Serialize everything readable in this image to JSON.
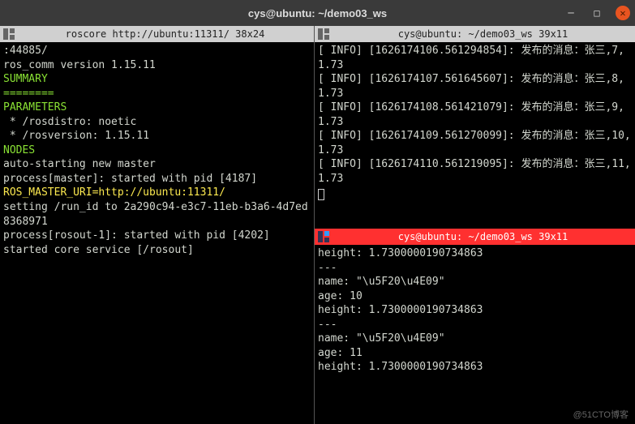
{
  "window": {
    "title": "cys@ubuntu: ~/demo03_ws"
  },
  "left": {
    "tab": "roscore http://ubuntu:11311/ 38x24",
    "lines": [
      {
        "cls": "c-white",
        "text": ":44885/"
      },
      {
        "cls": "c-white",
        "text": "ros_comm version 1.15.11"
      },
      {
        "cls": "",
        "text": ""
      },
      {
        "cls": "",
        "text": ""
      },
      {
        "cls": "c-green",
        "text": "SUMMARY"
      },
      {
        "cls": "c-green",
        "text": "========"
      },
      {
        "cls": "",
        "text": ""
      },
      {
        "cls": "c-green",
        "text": "PARAMETERS"
      },
      {
        "cls": "c-white",
        "text": " * /rosdistro: noetic"
      },
      {
        "cls": "c-white",
        "text": " * /rosversion: 1.15.11"
      },
      {
        "cls": "",
        "text": ""
      },
      {
        "cls": "c-green",
        "text": "NODES"
      },
      {
        "cls": "",
        "text": ""
      },
      {
        "cls": "c-white",
        "text": "auto-starting new master"
      },
      {
        "cls": "c-white",
        "text": "process[master]: started with pid [4187]"
      },
      {
        "cls": "c-yellow",
        "text": "ROS_MASTER_URI=http://ubuntu:11311/"
      },
      {
        "cls": "",
        "text": ""
      },
      {
        "cls": "c-white",
        "text": "setting /run_id to 2a290c94-e3c7-11eb-b3a6-4d7ed8368971"
      },
      {
        "cls": "c-white",
        "text": "process[rosout-1]: started with pid [4202]"
      },
      {
        "cls": "c-white",
        "text": "started core service [/rosout]"
      }
    ]
  },
  "rightTop": {
    "tab": "cys@ubuntu: ~/demo03_ws 39x11",
    "lines": [
      {
        "cls": "c-white",
        "text": "[ INFO] [1626174106.561294854]: 发布的消息：张三,7,1.73"
      },
      {
        "cls": "c-white",
        "text": "[ INFO] [1626174107.561645607]: 发布的消息：张三,8,1.73"
      },
      {
        "cls": "c-white",
        "text": "[ INFO] [1626174108.561421079]: 发布的消息：张三,9,1.73"
      },
      {
        "cls": "c-white",
        "text": "[ INFO] [1626174109.561270099]: 发布的消息：张三,10,1.73"
      },
      {
        "cls": "c-white",
        "text": "[ INFO] [1626174110.561219095]: 发布的消息：张三,11,1.73"
      }
    ]
  },
  "rightBottom": {
    "tab": "cys@ubuntu: ~/demo03_ws 39x11",
    "lines": [
      {
        "cls": "c-white",
        "text": "height: 1.7300000190734863"
      },
      {
        "cls": "c-white",
        "text": "---"
      },
      {
        "cls": "c-white",
        "text": "name: \"\\u5F20\\u4E09\""
      },
      {
        "cls": "c-white",
        "text": "age: 10"
      },
      {
        "cls": "c-white",
        "text": "height: 1.7300000190734863"
      },
      {
        "cls": "c-white",
        "text": "---"
      },
      {
        "cls": "c-white",
        "text": "name: \"\\u5F20\\u4E09\""
      },
      {
        "cls": "c-white",
        "text": "age: 11"
      },
      {
        "cls": "c-white",
        "text": "height: 1.7300000190734863"
      }
    ]
  },
  "watermark": "@51CTO博客"
}
